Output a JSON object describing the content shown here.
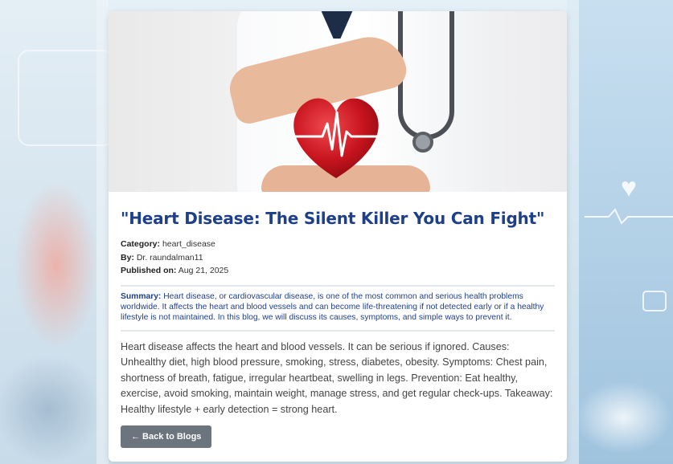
{
  "post": {
    "title": "\"Heart Disease: The Silent Killer You Can Fight\"",
    "category_label": "Category:",
    "category": "heart_disease",
    "by_label": "By:",
    "author": "Dr. raundalman11",
    "published_label": "Published on:",
    "published": "Aug 21, 2025",
    "summary_label": "Summary:",
    "summary": "Heart disease, or cardiovascular disease, is one of the most common and serious health problems worldwide. It affects the heart and blood vessels and can become life-threatening if not detected early or if a healthy lifestyle is not maintained. In this blog, we will discuss its causes, symptoms, and simple ways to prevent it.",
    "body": "Heart disease affects the heart and blood vessels. It can be serious if ignored. Causes: Unhealthy diet, high blood pressure, smoking, stress, diabetes, obesity. Symptoms: Chest pain, shortness of breath, fatigue, irregular heartbeat, swelling in legs. Prevention: Eat healthy, exercise, avoid smoking, maintain weight, manage stress, and get regular check-ups. Takeaway: Healthy lifestyle + early detection = strong heart."
  },
  "actions": {
    "back_label": "← Back to Blogs"
  },
  "colors": {
    "title": "#1e3f8a",
    "button": "#6c757d",
    "heart": "#c8141e"
  },
  "icons": {
    "hero": "doctor-heart-image",
    "back": "left-arrow"
  }
}
